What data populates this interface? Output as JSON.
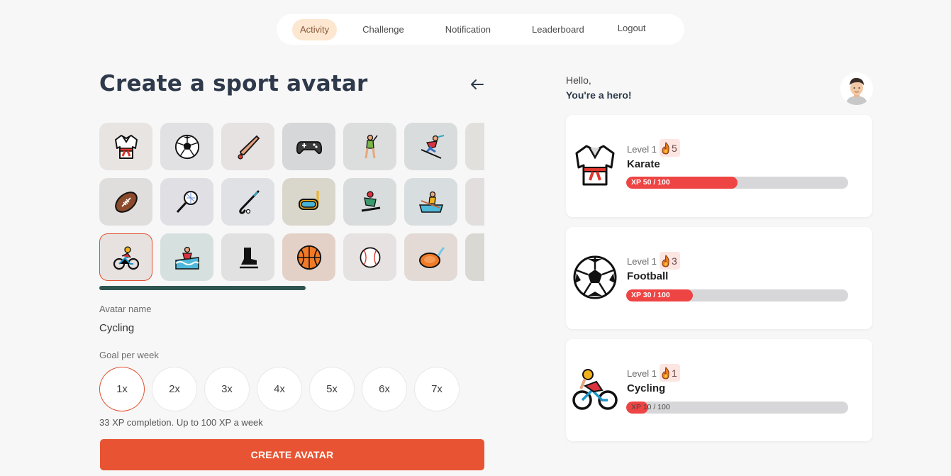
{
  "nav": {
    "items": [
      {
        "label": "Activity",
        "active": true
      },
      {
        "label": "Challenge",
        "active": false
      },
      {
        "label": "Notification",
        "active": false
      },
      {
        "label": "Leaderboard",
        "active": false
      },
      {
        "label": "Logout",
        "active": false
      }
    ]
  },
  "left": {
    "title": "Create a sport avatar",
    "back_icon": "arrow-left-icon",
    "avatars": [
      {
        "name": "karate-gi",
        "bg": "#e8e4e2"
      },
      {
        "name": "soccer-ball",
        "bg": "#e1e1e4"
      },
      {
        "name": "cricket",
        "bg": "#e6e2e2"
      },
      {
        "name": "video-game",
        "bg": "#d6d7d8"
      },
      {
        "name": "golfer",
        "bg": "#dcdedd"
      },
      {
        "name": "skier",
        "bg": "#d9dcdc"
      },
      {
        "name": "partial-1",
        "bg": "#e1e0dd"
      },
      {
        "name": "american-football",
        "bg": "#e0dedc"
      },
      {
        "name": "badminton",
        "bg": "#e0e0e4"
      },
      {
        "name": "field-hockey",
        "bg": "#dfe1e4"
      },
      {
        "name": "diving-mask",
        "bg": "#d9d6cc"
      },
      {
        "name": "snowboarder",
        "bg": "#d9dcdc"
      },
      {
        "name": "rowing",
        "bg": "#d8dedf"
      },
      {
        "name": "partial-2",
        "bg": "#e3dede"
      },
      {
        "name": "cyclist",
        "bg": "#e7e2e0"
      },
      {
        "name": "surfer",
        "bg": "#d6e0de"
      },
      {
        "name": "ice-skate",
        "bg": "#e1e1e1"
      },
      {
        "name": "basketball",
        "bg": "#e3d1c8"
      },
      {
        "name": "baseball",
        "bg": "#e6e2e2"
      },
      {
        "name": "rugby-flying-disc",
        "bg": "#e3dad6"
      },
      {
        "name": "partial-3",
        "bg": "#d9d8d3"
      }
    ],
    "selected_avatar_index": 14,
    "avatar_name_label": "Avatar name",
    "avatar_name_value": "Cycling",
    "goal_label": "Goal per week",
    "goals": [
      "1x",
      "2x",
      "3x",
      "4x",
      "5x",
      "6x",
      "7x"
    ],
    "selected_goal_index": 0,
    "note": "33 XP completion. Up to 100 XP a week",
    "create_button": "CREATE AVATAR"
  },
  "right": {
    "hello": "Hello,",
    "hero": "You're a hero!",
    "profile_icon": "user-avatar-icon",
    "cards": [
      {
        "icon": "karate-gi-icon",
        "level": "Level 1",
        "streak": "5",
        "name": "Karate",
        "xp_text": "XP 50 / 100",
        "xp_fraction": 0.5
      },
      {
        "icon": "soccer-ball-icon",
        "level": "Level 1",
        "streak": "3",
        "name": "Football",
        "xp_text": "XP 30 / 100",
        "xp_fraction": 0.3
      },
      {
        "icon": "cyclist-icon",
        "level": "Level 1",
        "streak": "1",
        "name": "Cycling",
        "xp_text": "XP 10 / 100",
        "xp_fraction": 0.1
      }
    ]
  },
  "colors": {
    "accent": "#e85433",
    "xp_fill": "#ee4444",
    "title": "#2e3a4b",
    "scrollbar": "#2f5551",
    "nav_active": "#fde7d0"
  }
}
